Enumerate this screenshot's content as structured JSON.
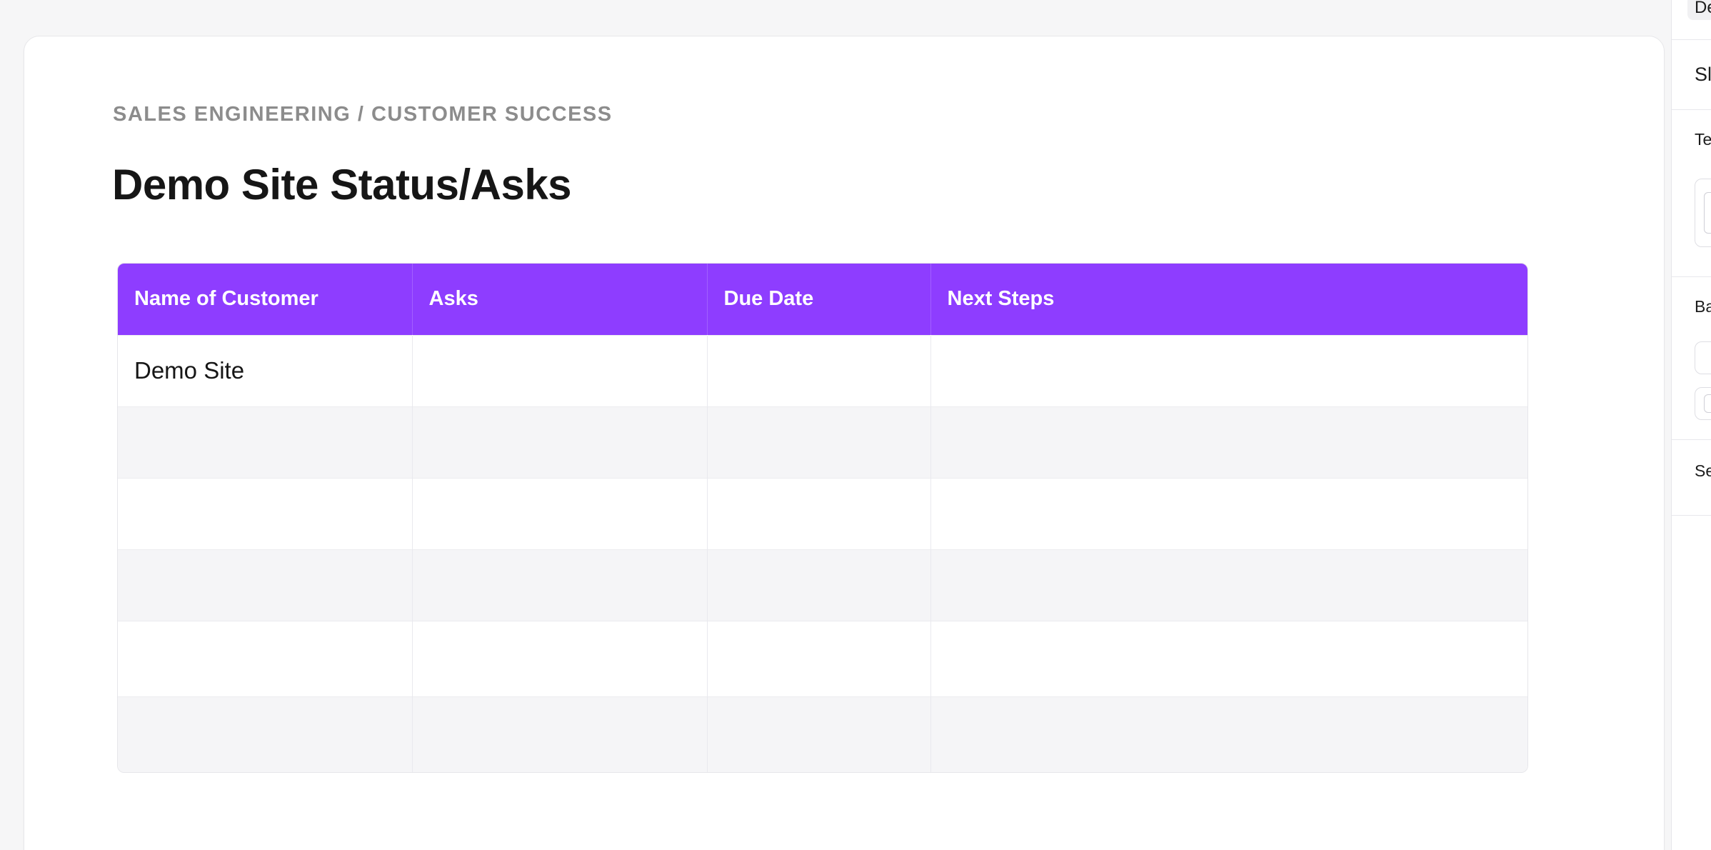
{
  "document": {
    "breadcrumb": "SALES ENGINEERING / CUSTOMER SUCCESS",
    "title": "Demo Site Status/Asks"
  },
  "table": {
    "columns": [
      "Name of Customer",
      "Asks",
      "Due Date",
      "Next Steps"
    ],
    "rows": [
      [
        "Demo Site",
        "",
        "",
        ""
      ],
      [
        "",
        "",
        "",
        ""
      ],
      [
        "",
        "",
        "",
        ""
      ],
      [
        "",
        "",
        "",
        ""
      ],
      [
        "",
        "",
        "",
        ""
      ],
      [
        "",
        "",
        "",
        ""
      ]
    ],
    "header_color": "#8e3dff",
    "stripe_color": "#f5f5f7"
  },
  "side_panel": {
    "chip_label": "De",
    "section_1_label": "Sl",
    "section_2_label": "Te",
    "section_3_label": "Ba",
    "section_4_label": "Se"
  }
}
